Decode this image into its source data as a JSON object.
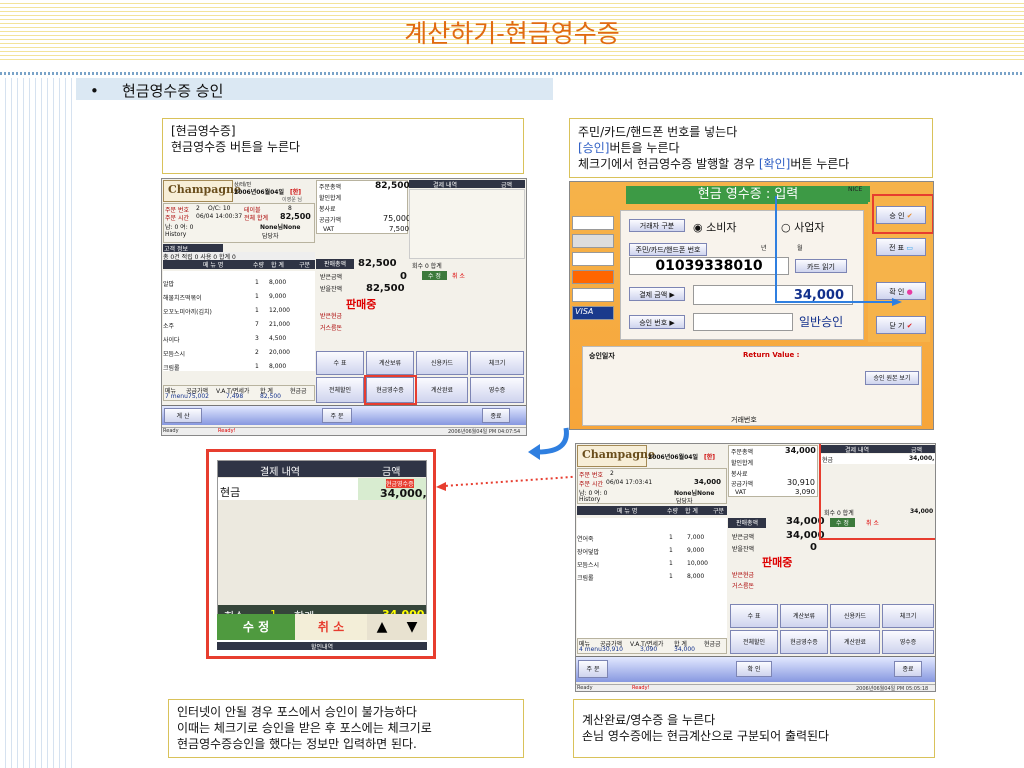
{
  "header": {
    "title": "계산하기-현금영수증"
  },
  "bullet": {
    "mark": "•",
    "text": "현금영수증 승인"
  },
  "notes": {
    "n1": {
      "line1": "[현금영수증]",
      "line2": "현금영수증 버튼을 누른다"
    },
    "n2": {
      "line1": "주민/카드/핸드폰 번호를 넣는다",
      "line2a": "[승인]",
      "line2b": "버튼을 누른다",
      "line3a": "체크기에서 현금영수증 발행할 경우 ",
      "line3b": "[확인]",
      "line3c": "버튼 누른다"
    },
    "n3": {
      "line1": "인터넷이 안될 경우 포스에서 승인이 불가능하다",
      "line2": "이때는 체크기로 승인을 받은 후 포스에는 체크기로",
      "line3": "현금영수증승인을 했다는 정보만 입력하면 된다."
    },
    "n4": {
      "line1": "계산완료/영수증 을 누른다",
      "line2": "손님 영수증에는 현금계산으로 구분되어 출력된다"
    }
  },
  "pos1": {
    "logo": "Champagne",
    "logo_sub": "THE NEXT POS SOLUTION",
    "date": "2006년06월04일",
    "badge": "[한]",
    "top_label": "상/테/민",
    "user": "이영운 님",
    "order_no_label": "주문 번호",
    "order_no": "2",
    "ovc_label": "O/C: 10",
    "table_label": "테이블",
    "table": "8",
    "order_time_label": "주문 시간",
    "order_time": "06/04 14:00:37",
    "total_sum_label": "전체 합계",
    "total_sum": "82,500",
    "people_label": "남: 0  여: 0",
    "member": "None님None",
    "history": "History",
    "staff": "담당자",
    "guest_info": "고객 정보",
    "count_row": "총 0건  적립  0 사용  0 합계  0",
    "cols": [
      "메 뉴 명",
      "수량",
      "합 계",
      "구분"
    ],
    "menu": [
      {
        "name": "알밥",
        "qty": "1",
        "amt": "8,000"
      },
      {
        "name": "해물치즈떡볶이",
        "qty": "1",
        "amt": "9,000"
      },
      {
        "name": "오꼬노미야끼(김치)",
        "qty": "1",
        "amt": "12,000"
      },
      {
        "name": "소주",
        "qty": "7",
        "amt": "21,000"
      },
      {
        "name": "사이다",
        "qty": "3",
        "amt": "4,500"
      },
      {
        "name": "모듬스시",
        "qty": "2",
        "amt": "20,000"
      },
      {
        "name": "크림롤",
        "qty": "1",
        "amt": "8,000"
      }
    ],
    "summary": [
      {
        "label": "주문총액",
        "value": "82,500"
      },
      {
        "label": "할인합계",
        "value": ""
      },
      {
        "label": "봉사료",
        "value": ""
      },
      {
        "label": "공급가액",
        "value": "75,000"
      },
      {
        "label": "VAT",
        "value": "7,500"
      }
    ],
    "sale_total_label": "판매총액",
    "sale_total": "82,500",
    "received_label": "받은금액",
    "received": "0",
    "remaining_label": "받을잔액",
    "remaining": "82,500",
    "selling": "판매중",
    "cash_recv": "받은현금",
    "change": "거스름돈",
    "pay_header": [
      "결제 내역",
      "금액"
    ],
    "count_label": "회수  0  합계",
    "edit": "수 정",
    "cancel": "취 소",
    "func_buttons": [
      "수 표",
      "계산보류",
      "신용카드",
      "체크기",
      "전체할인",
      "현금영수증",
      "계산완료",
      "영수증"
    ],
    "foot_labels": [
      "메뉴",
      "공급가액",
      "V.A.T/면세가",
      "합 계",
      "현금금"
    ],
    "foot_values": [
      "7 menu",
      "75,002",
      "7,498",
      "82,500",
      ""
    ],
    "calc_btn": "계 산",
    "order_btn": "주 문",
    "end_btn": "종료",
    "status_left": "Ready",
    "status_mid": "Ready!",
    "status_right": "2006년06월04일  PM 04:07:54"
  },
  "receipt": {
    "title": "현금 영수증 : 입력",
    "nice": "NICE",
    "trade_type": "거래자 구분",
    "opt1": "소비자",
    "opt2": "사업자",
    "id_label": "주민/카드/핸드폰 번호",
    "year": "년",
    "month": "월",
    "number": "01039338010",
    "card_read": "카드 읽기",
    "amount_label": "결제 금액 ▶",
    "amount": "34,000",
    "approval_label": "승인 번호 ▶",
    "normal_approval": "일반승인",
    "approval_date": "승인일자",
    "return_value": "Return Value :",
    "original_view": "승인 원본 보기",
    "trade_no": "거래번호",
    "side_buttons": [
      "승 인",
      "전 표",
      "확 인",
      "닫 기"
    ]
  },
  "zoom": {
    "pay_header": [
      "결제 내역",
      "금액"
    ],
    "item": "현금",
    "item_tag": "현금영수증",
    "item_amount": "34,000,",
    "count_label": "회수",
    "count": "1",
    "sum_label": "합계",
    "sum": "34,000",
    "edit": "수 정",
    "cancel": "취 소",
    "up": "▲",
    "down": "▼",
    "bottom_hint": "할인내역"
  },
  "pos2": {
    "logo": "Champagne",
    "date": "2006년06월04일",
    "badge": "[한]",
    "order_no": "2",
    "order_time": "06/04 17:03:41",
    "total_sum": "34,000",
    "summary": [
      {
        "label": "주문총액",
        "value": "34,000"
      },
      {
        "label": "할인합계",
        "value": ""
      },
      {
        "label": "봉사료",
        "value": ""
      },
      {
        "label": "공급가액",
        "value": "30,910"
      },
      {
        "label": "VAT",
        "value": "3,090"
      }
    ],
    "menu": [
      {
        "name": "연어죽",
        "qty": "1",
        "amt": "7,000"
      },
      {
        "name": "장어덮밥",
        "qty": "1",
        "amt": "9,000"
      },
      {
        "name": "모듬스시",
        "qty": "1",
        "amt": "10,000"
      },
      {
        "name": "크림롤",
        "qty": "1",
        "amt": "8,000"
      }
    ],
    "sale_total": "34,000",
    "received": "34,000",
    "remaining": "0",
    "selling": "판매중",
    "pay_item": "현금",
    "pay_amt": "34,000,",
    "count_sum": "34,000",
    "foot_values": [
      "4 menu",
      "30,910",
      "3,090",
      "34,000",
      ""
    ],
    "confirm_btn": "확 인",
    "status_right": "2006년06월04일  PM 05:05:18"
  },
  "colors": {
    "accent": "#e06a12",
    "red": "#e73d2f",
    "blue": "#2f5fc4"
  }
}
